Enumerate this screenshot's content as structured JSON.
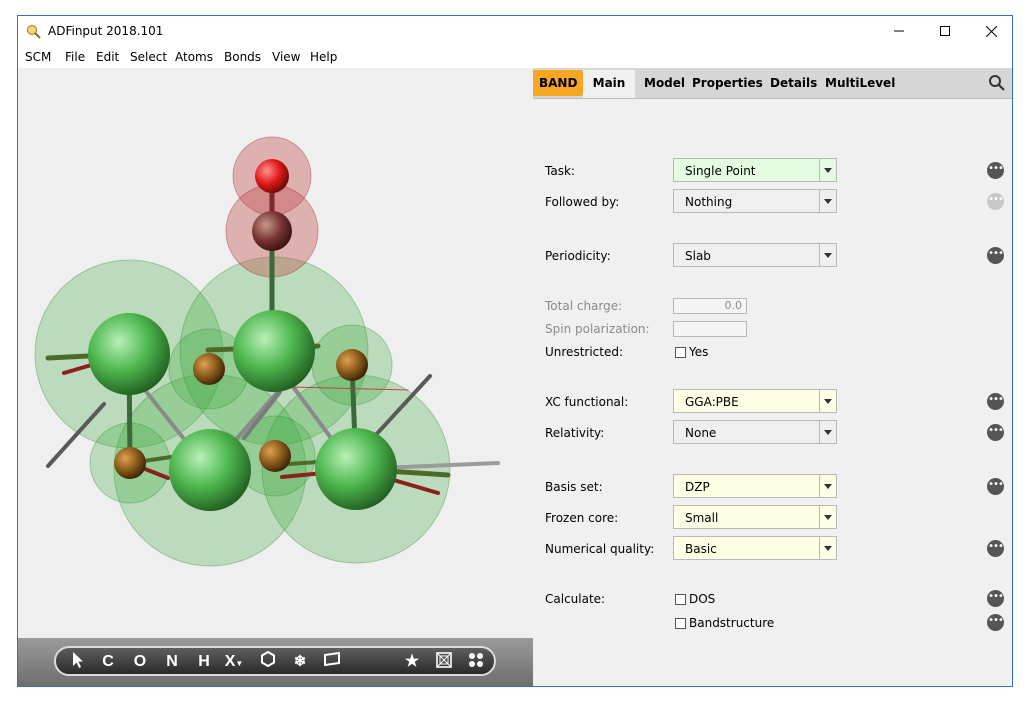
{
  "window": {
    "title": "ADFinput 2018.101"
  },
  "menubar": {
    "items": [
      {
        "label": "SCM"
      },
      {
        "label": "File"
      },
      {
        "label": "Edit"
      },
      {
        "label": "Select"
      },
      {
        "label": "Atoms"
      },
      {
        "label": "Bonds"
      },
      {
        "label": "View"
      },
      {
        "label": "Help"
      }
    ]
  },
  "tabs": {
    "band": "BAND",
    "main": "Main",
    "others": [
      "Model",
      "Properties",
      "Details",
      "MultiLevel"
    ]
  },
  "toolbar": {
    "tools": [
      "C",
      "O",
      "N",
      "H",
      "X"
    ]
  },
  "form": {
    "task": {
      "label": "Task:",
      "value": "Single Point"
    },
    "followed_by": {
      "label": "Followed by:",
      "value": "Nothing"
    },
    "periodicity": {
      "label": "Periodicity:",
      "value": "Slab"
    },
    "total_charge": {
      "label": "Total charge:",
      "value": "0.0"
    },
    "spin_polarization": {
      "label": "Spin polarization:",
      "value": ""
    },
    "unrestricted": {
      "label": "Unrestricted:",
      "option": "Yes",
      "checked": false
    },
    "xc_functional": {
      "label": "XC functional:",
      "value": "GGA:PBE"
    },
    "relativity": {
      "label": "Relativity:",
      "value": "None"
    },
    "basis_set": {
      "label": "Basis set:",
      "value": "DZP"
    },
    "frozen_core": {
      "label": "Frozen core:",
      "value": "Small"
    },
    "numerical_quality": {
      "label": "Numerical quality:",
      "value": "Basic"
    },
    "calculate": {
      "label": "Calculate:",
      "dos": "DOS",
      "bandstructure": "Bandstructure"
    }
  },
  "colors": {
    "band_tab": "#f5a623",
    "task_bg": "#e4fbe2",
    "highlight_bg": "#fefee4",
    "carbon_green": "#4fb84f",
    "oxygen_red": "#e01818",
    "hetero_brown": "#8a5a1a"
  }
}
